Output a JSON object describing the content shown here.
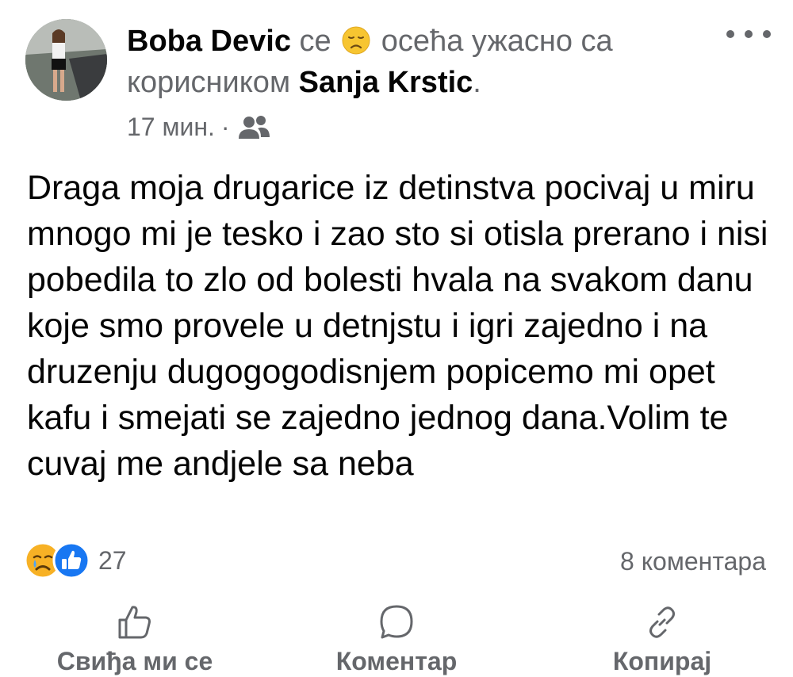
{
  "post": {
    "author": "Boba Devic",
    "feeling_prefix": "се",
    "feeling_text": "осећа ужасно са",
    "with_prefix": "корисником",
    "tagged_user": "Sanja Krstic",
    "tagged_suffix": ".",
    "timestamp": "17 мин.",
    "separator": "·",
    "body": "Draga moja drugarice iz detinstva pocivaj u miru mnogo mi je tesko i zao sto si otisla prerano i nisi pobedila to zlo od bolesti hvala na svakom danu koje smo provele u detnjstu i igri zajedno i na druzenju dugogogodisnjem popicemo mi opet kafu i smejati se zajedno jednog dana.Volim te cuvaj me andjele sa neba"
  },
  "feeling_icon": "sad-face-emoji-icon",
  "audience_icon": "friends-icon",
  "reactions": {
    "icons": [
      "crying-face-reaction-icon",
      "thumbs-up-reaction-icon"
    ],
    "count": "27"
  },
  "comments_count": "8 коментара",
  "actions": {
    "like_label": "Свиђа ми се",
    "comment_label": "Коментар",
    "copy_label": "Копирај"
  },
  "colors": {
    "text_primary": "#050505",
    "text_secondary": "#65676b",
    "like_blue": "#1877f2",
    "reaction_yellow": "#f7b125"
  }
}
